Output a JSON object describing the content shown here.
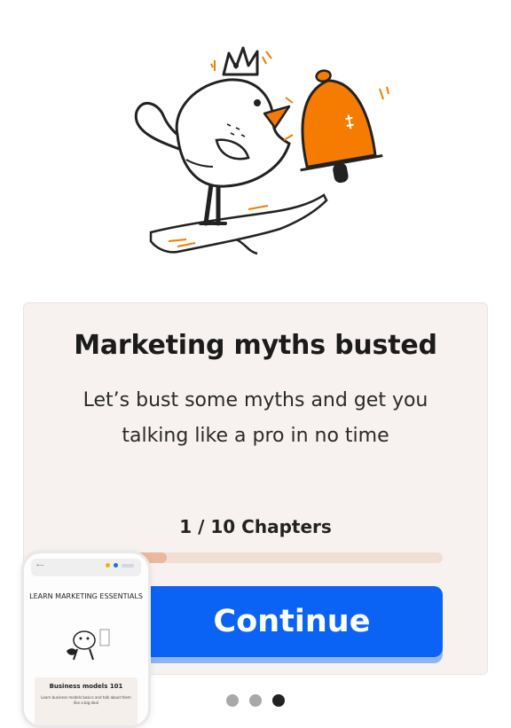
{
  "illustration": {
    "name": "bird-with-crown-and-bell"
  },
  "card": {
    "title": "Marketing myths busted",
    "subtitle": "Let’s bust some myths and get you talking like a pro in no time",
    "chapters_label": "1 / 10 Chapters",
    "progress_fraction": 0.1,
    "continue_label": "Continue"
  },
  "pager": {
    "count": 3,
    "active_index": 2
  },
  "phone_preview": {
    "course_title": "LEARN MARKETING ESSENTIALS",
    "card_title": "Business models 101",
    "card_text": "Learn business models basics and talk about them like a big deal"
  },
  "colors": {
    "accent": "#0a63f4",
    "bell": "#f57c00",
    "card_bg": "#f7f2ef",
    "progress_track": "#f1dfd5"
  }
}
